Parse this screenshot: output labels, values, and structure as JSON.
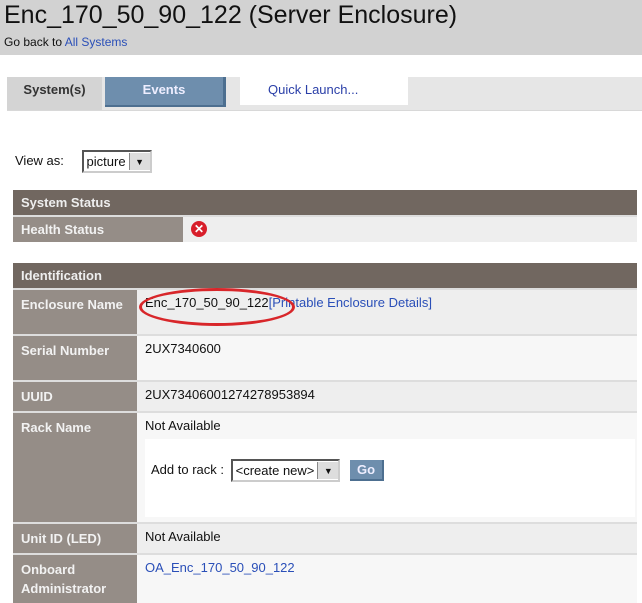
{
  "header": {
    "title": "Enc_170_50_90_122 (Server Enclosure)",
    "back_prefix": "Go back to",
    "back_link": "All Systems"
  },
  "tabs": [
    {
      "label": "System(s)"
    },
    {
      "label": "Events"
    },
    {
      "label": "Quick Launch..."
    }
  ],
  "view": {
    "label": "View as:",
    "value": "picture"
  },
  "system_status": {
    "title": "System Status",
    "health_label": "Health Status",
    "health_icon": "error-icon"
  },
  "identification": {
    "title": "Identification",
    "enclosure_name_label": "Enclosure Name",
    "enclosure_name": "Enc_170_50_90_122",
    "printable_link": "[Printable Enclosure Details]",
    "serial_label": "Serial Number",
    "serial": "2UX7340600",
    "uuid_label": "UUID",
    "uuid": "2UX73406001274278953894",
    "rack_label": "Rack Name",
    "rack": "Not Available",
    "add_to_rack_label": "Add to rack :",
    "rack_select": "<create new>",
    "go_label": "Go",
    "unit_label": "Unit ID (LED)",
    "unit": "Not Available",
    "oa_label": "Onboard Administrator",
    "oa": "OA_Enc_170_50_90_122"
  },
  "colors": {
    "header_bg": "#716760",
    "label_bg": "#958d87",
    "accent": "#6e8ead",
    "highlight": "#d8262a"
  }
}
